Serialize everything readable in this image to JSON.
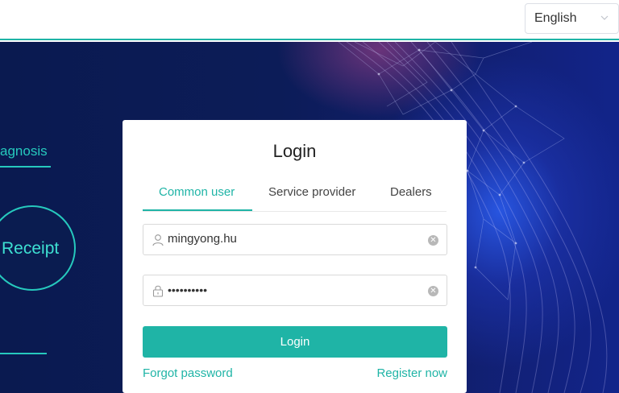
{
  "header": {
    "language": {
      "selected": "English"
    }
  },
  "hero": {
    "left_menu_text": "agnosis",
    "receipt_label": "Receipt"
  },
  "login": {
    "title": "Login",
    "tabs": [
      {
        "label": "Common user",
        "active": true
      },
      {
        "label": "Service provider",
        "active": false
      },
      {
        "label": "Dealers",
        "active": false
      }
    ],
    "username": {
      "value": "mingyong.hu",
      "icon": "user-icon"
    },
    "password": {
      "value": "••••••••••",
      "icon": "lock-icon"
    },
    "submit_label": "Login",
    "forgot_label": "Forgot password",
    "register_label": "Register now"
  },
  "colors": {
    "accent": "#1fb4a6",
    "hero_dark": "#0c1c58",
    "hero_blue": "#2958e6"
  }
}
